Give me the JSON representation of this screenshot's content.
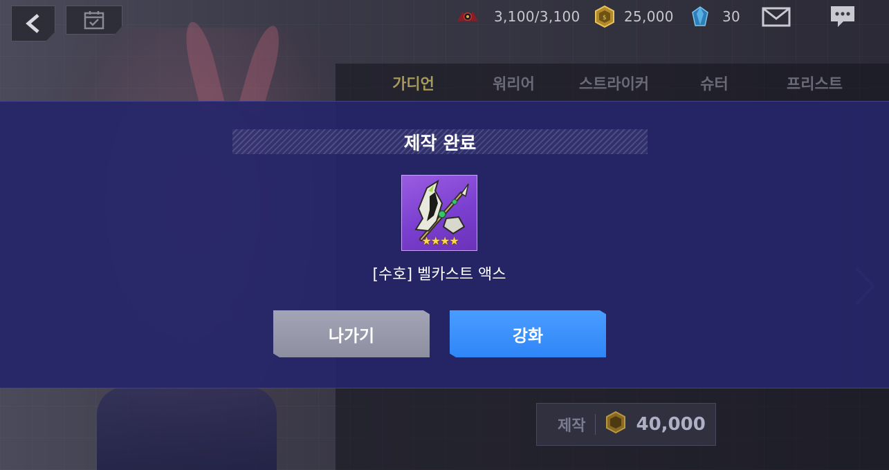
{
  "topbar": {
    "stamina": "3,100/3,100",
    "gold": "25,000",
    "gems": "30",
    "icons": {
      "back": "back-arrow-icon",
      "mission": "calendar-check-icon",
      "stamina": "stamina-emblem-icon",
      "gold": "gold-coin-icon",
      "gem": "gem-icon",
      "mail": "mail-icon",
      "chat": "chat-icon"
    }
  },
  "tabs": [
    {
      "label": "가디언",
      "active": true
    },
    {
      "label": "워리어",
      "active": false
    },
    {
      "label": "스트라이커",
      "active": false
    },
    {
      "label": "슈터",
      "active": false
    },
    {
      "label": "프리스트",
      "active": false
    }
  ],
  "craft_bar": {
    "label": "제작",
    "price": "40,000"
  },
  "modal": {
    "title": "제작 완료",
    "item": {
      "name": "[수호] 벨카스트 액스",
      "stars": "★★★★",
      "icon": "axe-weapon-icon"
    },
    "exit_label": "나가기",
    "enhance_label": "강화"
  },
  "colors": {
    "modal_bg": "#26266a",
    "enhance_button": "#3a90fb",
    "exit_button": "#9799ab",
    "item_bg": "#8a4bd8",
    "star": "#ffd94a"
  }
}
